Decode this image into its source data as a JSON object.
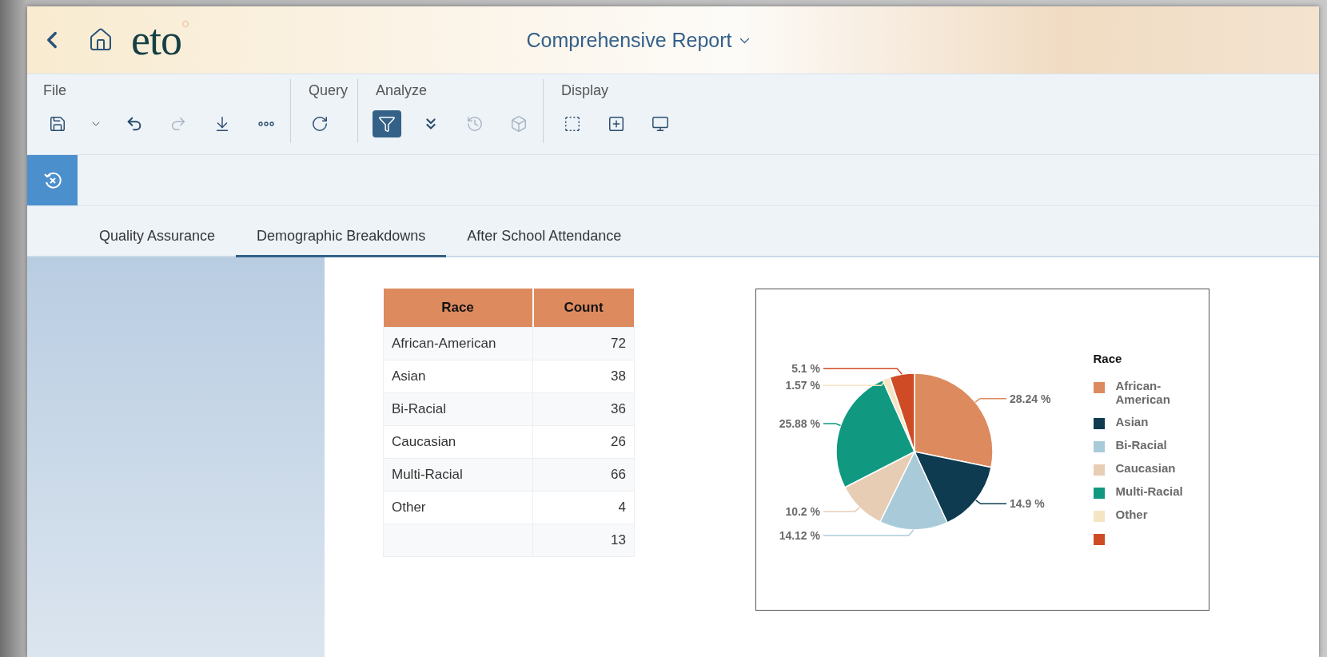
{
  "header": {
    "logo": "eto",
    "title": "Comprehensive Report"
  },
  "toolbar": {
    "groups": [
      {
        "label": "File",
        "tools": [
          {
            "kind": "save",
            "selected": false,
            "disabled": false
          },
          {
            "kind": "caret",
            "selected": false,
            "disabled": false
          },
          {
            "kind": "undo",
            "selected": false,
            "disabled": false
          },
          {
            "kind": "redo",
            "selected": false,
            "disabled": true
          },
          {
            "kind": "download",
            "selected": false,
            "disabled": false
          },
          {
            "kind": "more",
            "selected": false,
            "disabled": false
          }
        ]
      },
      {
        "label": "Query",
        "tools": [
          {
            "kind": "refresh",
            "selected": false,
            "disabled": false
          }
        ]
      },
      {
        "label": "Analyze",
        "tools": [
          {
            "kind": "filter",
            "selected": true,
            "disabled": false
          },
          {
            "kind": "drill",
            "selected": false,
            "disabled": false
          },
          {
            "kind": "history",
            "selected": false,
            "disabled": true
          },
          {
            "kind": "cube",
            "selected": false,
            "disabled": true
          }
        ]
      },
      {
        "label": "Display",
        "tools": [
          {
            "kind": "new-page",
            "selected": false,
            "disabled": false
          },
          {
            "kind": "insert",
            "selected": false,
            "disabled": false
          },
          {
            "kind": "monitor",
            "selected": false,
            "disabled": false
          }
        ]
      }
    ]
  },
  "tabs": [
    {
      "label": "Quality Assurance",
      "selected": false
    },
    {
      "label": "Demographic Breakdowns",
      "selected": true
    },
    {
      "label": "After School Attendance",
      "selected": false
    }
  ],
  "table": {
    "columns": [
      "Race",
      "Count"
    ],
    "rows": [
      {
        "race": "African-American",
        "count": "72"
      },
      {
        "race": "Asian",
        "count": "38"
      },
      {
        "race": "Bi-Racial",
        "count": "36"
      },
      {
        "race": "Caucasian",
        "count": "26"
      },
      {
        "race": "Multi-Racial",
        "count": "66"
      },
      {
        "race": "Other",
        "count": "4"
      },
      {
        "count": "13"
      }
    ]
  },
  "chart_data": {
    "type": "pie",
    "categories": [
      "African-American",
      "Asian",
      "Bi-Racial",
      "Caucasian",
      "Multi-Racial",
      "Other",
      null
    ],
    "series": [
      {
        "name": "Race",
        "values": [
          28.24,
          14.9,
          14.12,
          10.2,
          25.88,
          1.57,
          5.1
        ]
      }
    ],
    "colors": [
      "#dd8a5e",
      "#0e3b50",
      "#a9cbd9",
      "#e8cdb5",
      "#109980",
      "#f5e6c3",
      "#cf4b26"
    ],
    "value_labels": [
      "28.24 %",
      "14.9 %",
      "14.12 %",
      "10.2 %",
      "25.88 %",
      "1.57 %",
      "5.1 %"
    ]
  }
}
